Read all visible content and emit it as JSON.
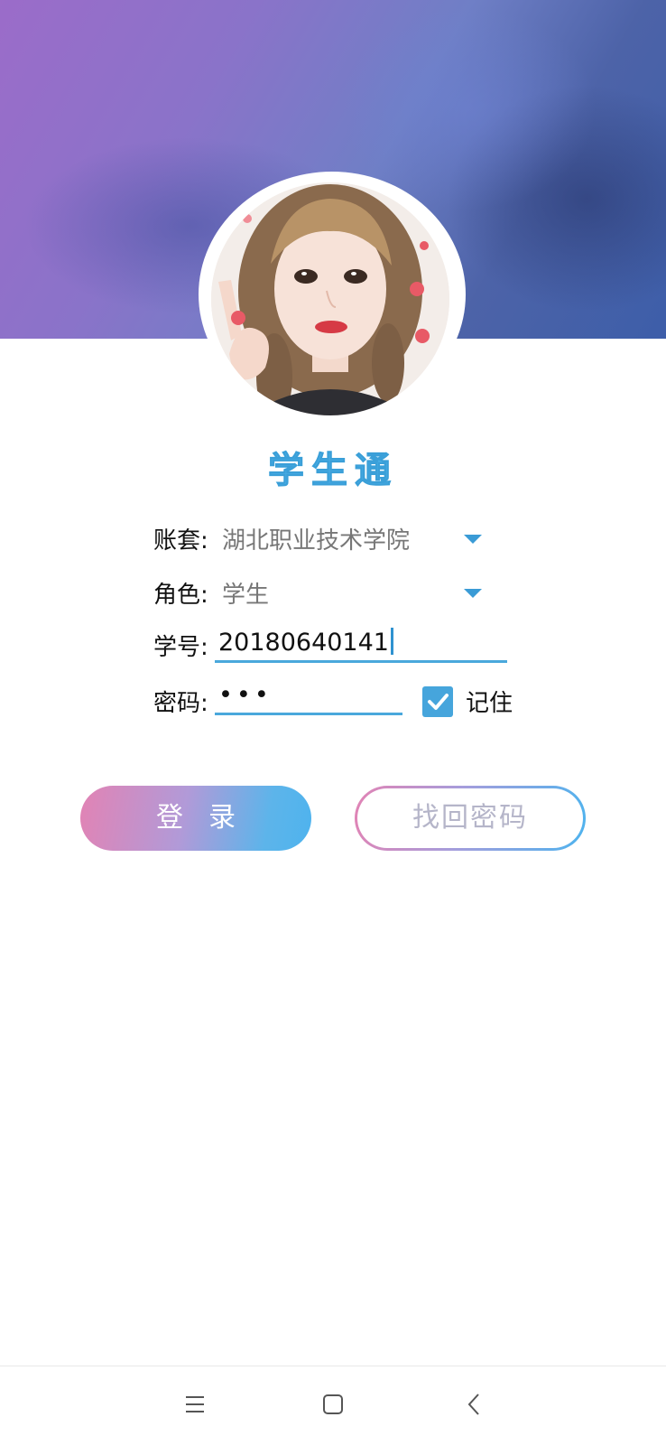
{
  "app": {
    "title": "学生通"
  },
  "form": {
    "account_set": {
      "label": "账套:",
      "value": "湖北职业技术学院"
    },
    "role": {
      "label": "角色:",
      "value": "学生"
    },
    "student_id": {
      "label": "学号:",
      "value": "20180640141"
    },
    "password": {
      "label": "密码:",
      "masked_value": "•••"
    },
    "remember": {
      "label": "记住",
      "checked": true
    }
  },
  "buttons": {
    "login_label": "登录",
    "recover_label": "找回密码"
  },
  "nav": {
    "items": [
      "menu-icon",
      "home-icon",
      "back-icon"
    ]
  },
  "colors": {
    "accent": "#4aaee6",
    "title": "#4aaee6",
    "gradient_start": "#e283b4",
    "gradient_end": "#4eb3ee"
  }
}
